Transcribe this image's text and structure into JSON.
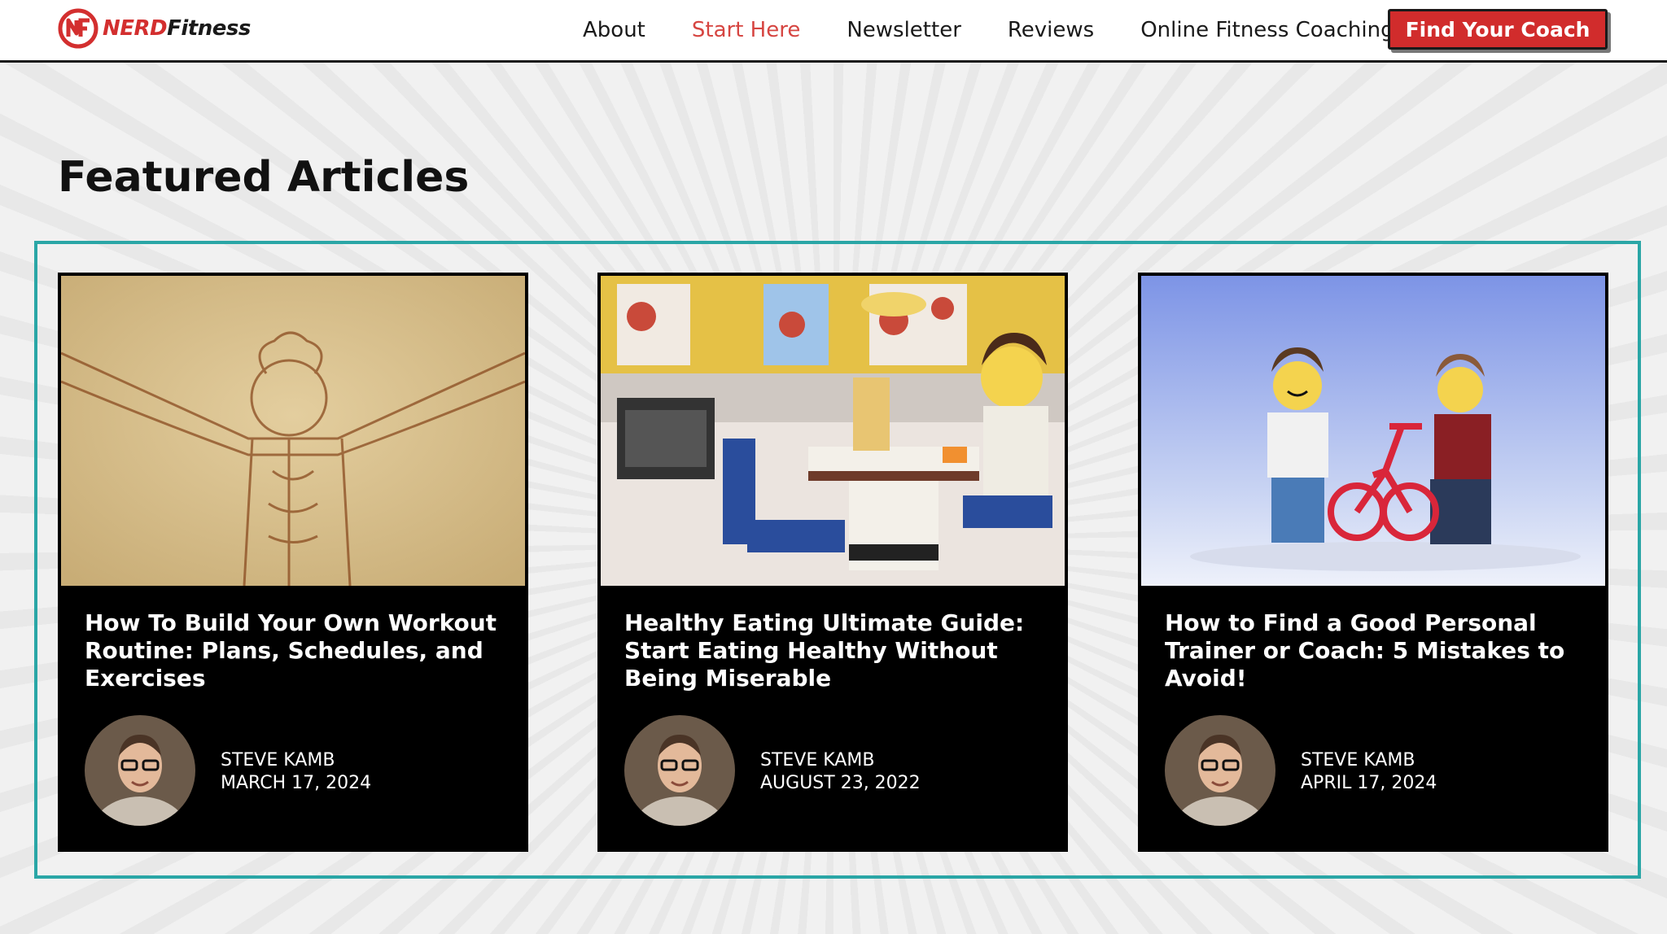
{
  "header": {
    "logo": {
      "nerd": "NERD",
      "fitness": "Fitness"
    },
    "nav": [
      {
        "label": "About",
        "active": false
      },
      {
        "label": "Start Here",
        "active": true
      },
      {
        "label": "Newsletter",
        "active": false
      },
      {
        "label": "Reviews",
        "active": false
      },
      {
        "label": "Online Fitness Coaching",
        "active": false
      }
    ],
    "cta_label": "Find Your Coach"
  },
  "section": {
    "title": "Featured Articles"
  },
  "articles": [
    {
      "title": "How To Build Your Own Workout Routine: Plans, Schedules, and Exercises",
      "author": "STEVE KAMB",
      "date": "MARCH 17, 2024",
      "image": "vitruvian-man-sketch"
    },
    {
      "title": "Healthy Eating Ultimate Guide: Start Eating Healthy Without Being Miserable",
      "author": "STEVE KAMB",
      "date": "AUGUST 23, 2022",
      "image": "lego-kitchen-scene"
    },
    {
      "title": "How to Find a Good Personal Trainer or Coach: 5 Mistakes to Avoid!",
      "author": "STEVE KAMB",
      "date": "APRIL 17, 2024",
      "image": "lego-bicycle-scene"
    }
  ],
  "colors": {
    "accent": "#d64541",
    "cta": "#d12c2c",
    "frame": "#2aa6a6"
  }
}
